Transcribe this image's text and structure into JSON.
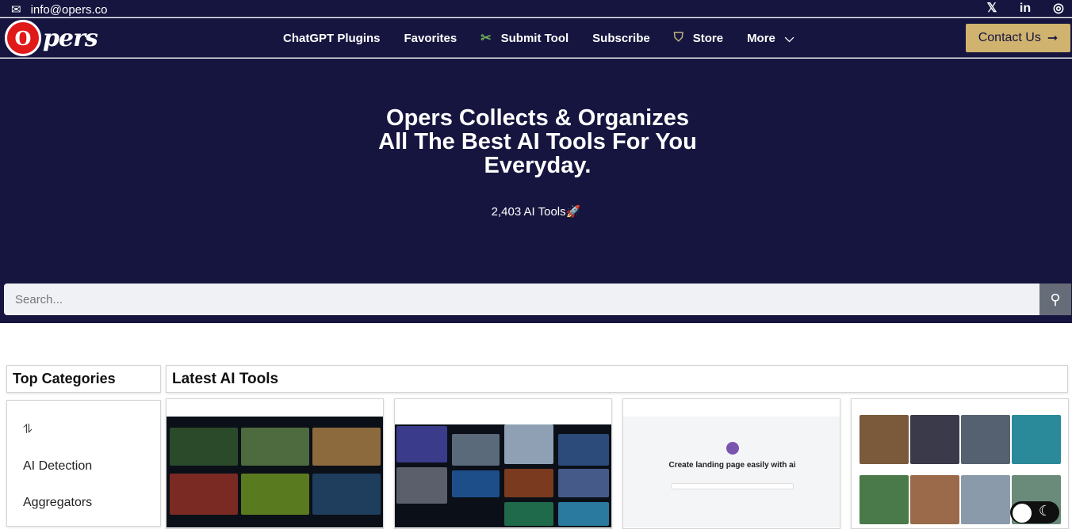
{
  "topbar": {
    "email": "info@opers.co",
    "social": [
      {
        "icon": "x-twitter-icon",
        "glyph": "𝕏"
      },
      {
        "icon": "linkedin-icon",
        "glyph": "in"
      },
      {
        "icon": "instagram-icon",
        "glyph": "◎"
      }
    ]
  },
  "brand": {
    "logo_letter": "O",
    "logo_word": "pers"
  },
  "nav": {
    "items": [
      "ChatGPT Plugins",
      "Favorites",
      "Submit Tool",
      "Subscribe",
      "Store",
      "More"
    ]
  },
  "contact": {
    "label": "Contact Us",
    "arrow": "➞"
  },
  "hero": {
    "headline": "Opers Collects & Organizes All The Best AI Tools For You Everyday.",
    "count": "2,403 AI Tools🚀"
  },
  "search": {
    "placeholder": "Search..."
  },
  "sidebar": {
    "title": "Top Categories",
    "items": [
      "AI Detection",
      "Aggregators"
    ]
  },
  "main": {
    "title": "Latest AI Tools"
  },
  "cards": [
    {
      "caption": ""
    },
    {
      "caption": ""
    },
    {
      "caption": "Create landing page easily with ai"
    },
    {
      "caption": ""
    }
  ],
  "colors": {
    "navy": "#16153f",
    "gold": "#cfb36e",
    "red": "#e01919"
  }
}
